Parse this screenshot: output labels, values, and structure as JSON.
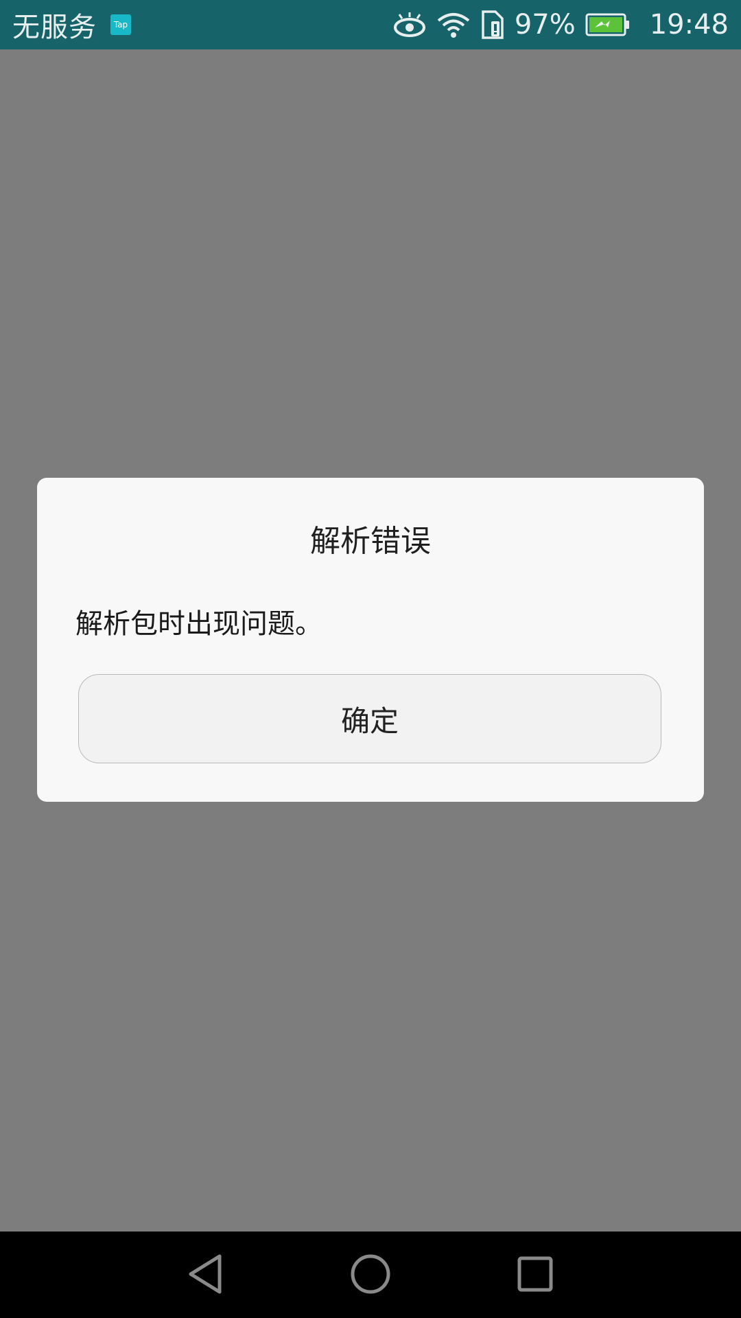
{
  "status_bar": {
    "carrier": "无服务",
    "notification_badge": "Tap",
    "battery_percent": "97%",
    "time": "19:48",
    "icons": [
      "eye-comfort-icon",
      "wifi-icon",
      "sim-alert-icon",
      "battery-charging-icon"
    ]
  },
  "dialog": {
    "title": "解析错误",
    "message": "解析包时出现问题。",
    "confirm_label": "确定"
  },
  "nav_bar": {
    "icons": [
      "back-icon",
      "home-icon",
      "recents-icon"
    ]
  },
  "colors": {
    "status_bar_bg": "#17636a",
    "scrim": "#7d7d7d",
    "dialog_bg": "#f8f8f8",
    "badge": "#19b8c9",
    "battery_fill": "#5cc23a"
  }
}
